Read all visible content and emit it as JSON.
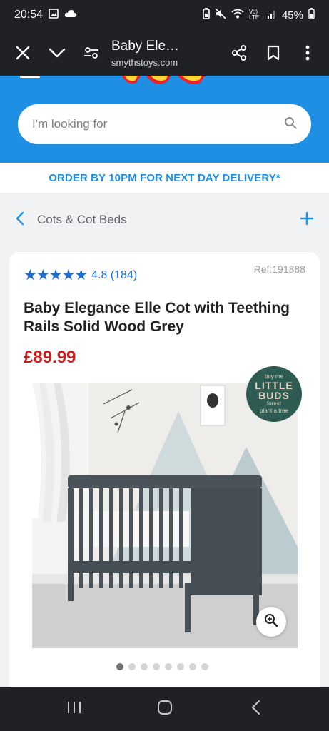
{
  "status_bar": {
    "time": "20:54",
    "battery": "45%",
    "network_label": "Vo) LTE"
  },
  "browser": {
    "title": "Baby Ele…",
    "url": "smythstoys.com"
  },
  "search": {
    "placeholder": "I'm looking for"
  },
  "banner": {
    "text": "ORDER BY 10PM FOR NEXT DAY DELIVERY*"
  },
  "breadcrumb": {
    "label": "Cots & Cot Beds"
  },
  "product": {
    "stars": "★★★★★",
    "rating_value": 4.8,
    "rating_text": "4.8 (184)",
    "ref": "Ref:191888",
    "title": "Baby Elegance Elle Cot with Teething Rails Solid Wood Grey",
    "price": "£89.99",
    "badge": {
      "top": "buy me",
      "main_line1": "LITTLE",
      "main_line2": "BUDS",
      "sub": "forest",
      "bottom": "plant a tree"
    },
    "gallery": {
      "count": 8,
      "active_index": 0
    }
  },
  "colors": {
    "brand_blue": "#1e8fe3",
    "price_red": "#cc1d1d",
    "bar_dark": "#202124"
  },
  "icons": {
    "close": "close-icon",
    "chevron_down": "chevron-down-icon",
    "tune": "tune-icon",
    "share": "share-icon",
    "bookmark": "bookmark-icon",
    "more": "more-vert-icon",
    "search": "search-icon",
    "back": "chevron-left-icon",
    "expand": "plus-icon",
    "zoom": "zoom-in-icon"
  }
}
